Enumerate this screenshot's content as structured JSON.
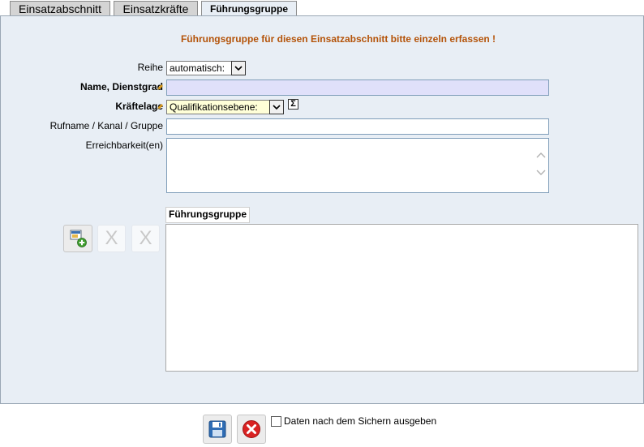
{
  "tabs": [
    {
      "label": "Einsatzabschnitt",
      "active": false
    },
    {
      "label": "Einsatzkräfte",
      "active": false
    },
    {
      "label": "Führungsgruppe",
      "active": true
    }
  ],
  "form": {
    "hint": "Führungsgruppe für diesen Einsatzabschnitt bitte einzeln erfassen !",
    "reihe": {
      "label": "Reihe",
      "value": "automatisch:"
    },
    "name": {
      "label": "Name, Dienstgrad",
      "value": ""
    },
    "kraeftelage": {
      "label": "Kräftelage",
      "value": "Qualifikationsebene:"
    },
    "rufname": {
      "label": "Rufname / Kanal / Gruppe",
      "value": ""
    },
    "erreichbarkeit": {
      "label": "Erreichbarkeit(en)",
      "value": ""
    }
  },
  "group": {
    "label": "Führungsgruppe",
    "remove_glyph": "X"
  },
  "footer": {
    "checkbox_label": "Daten nach dem Sichern ausgeben",
    "checked": false
  },
  "colors": {
    "panel": "#e8eef5",
    "hint": "#b45309",
    "required_field": "#e0e0fa",
    "highlight_field": "#ffffd8"
  },
  "icons": [
    "edit-pencil-icon",
    "chevron-down-icon",
    "sigma-icon",
    "add-entry-icon",
    "save-icon",
    "cancel-icon",
    "scroll-up-icon",
    "scroll-down-icon"
  ]
}
